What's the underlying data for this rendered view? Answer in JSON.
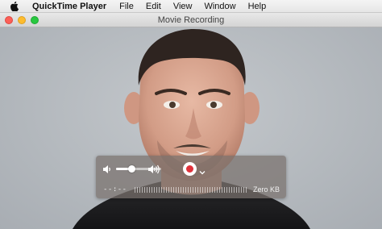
{
  "menubar": {
    "app_name": "QuickTime Player",
    "items": [
      "File",
      "Edit",
      "View",
      "Window",
      "Help"
    ]
  },
  "window": {
    "title": "Movie Recording"
  },
  "hud": {
    "volume_level": 0.35,
    "timecode": "--:--",
    "file_size": "Zero KB",
    "record_color": "#e0313a"
  },
  "icons": {
    "apple": "apple-logo-icon",
    "volume_low": "speaker-low-icon",
    "volume_high": "speaker-high-icon",
    "record": "record-icon",
    "chevron": "chevron-down-icon"
  }
}
